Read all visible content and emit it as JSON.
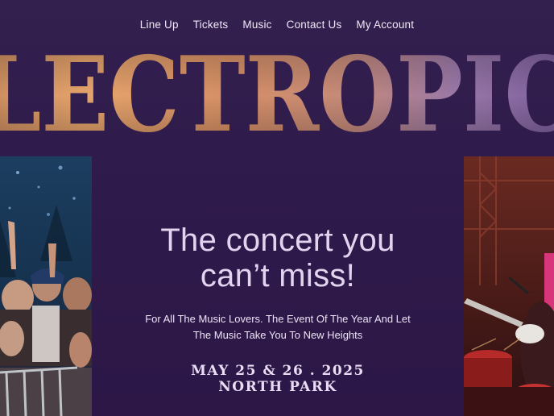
{
  "nav": {
    "items": [
      {
        "label": "Line Up"
      },
      {
        "label": "Tickets"
      },
      {
        "label": "Music"
      },
      {
        "label": "Contact Us"
      },
      {
        "label": "My Account"
      }
    ]
  },
  "hero": {
    "wordmark": "LECTROPIC",
    "headline_line1": "The concert you",
    "headline_line2": "can’t miss!",
    "subtext_line1": "For All The Music Lovers. The Event Of The Year And Let",
    "subtext_line2": "The Music Take You To New Heights",
    "date": "MAY 25 & 26 . 2025",
    "venue": "NORTH PARK"
  },
  "colors": {
    "background": "#311a4d",
    "text": "#e2d3ee",
    "wordmark_warm": "#e8a86a",
    "wordmark_cool": "#7a5a9c"
  }
}
